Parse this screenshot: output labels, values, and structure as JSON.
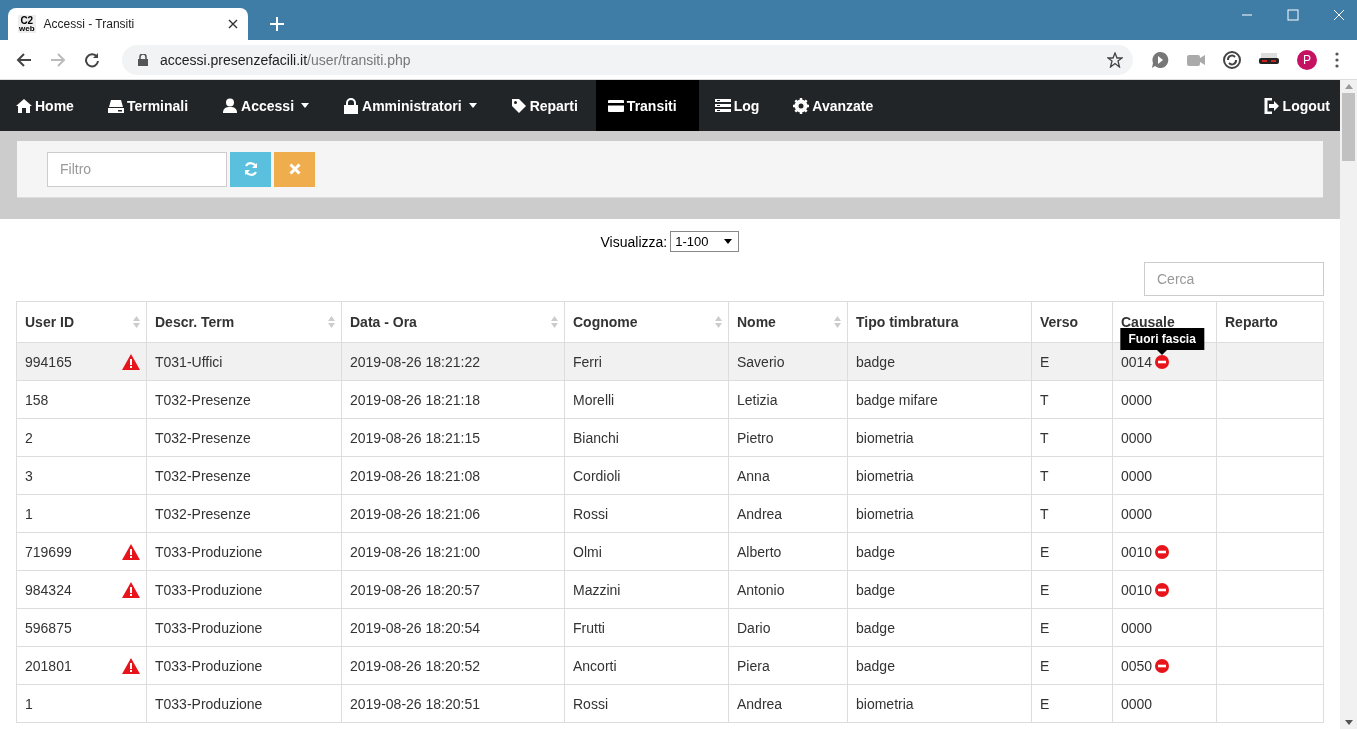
{
  "browser": {
    "favicon_text": [
      "C2",
      "web"
    ],
    "tab_title": "Accessi - Transiti",
    "url_host": "accessi.presenzefacili.it",
    "url_path": "/user/transiti.php",
    "profile_initial": "P"
  },
  "navbar": {
    "items": [
      {
        "label": "Home",
        "dropdown": false,
        "selected": false
      },
      {
        "label": "Terminali",
        "dropdown": false,
        "selected": false
      },
      {
        "label": "Accessi",
        "dropdown": true,
        "selected": false
      },
      {
        "label": "Amministratori",
        "dropdown": true,
        "selected": false
      },
      {
        "label": "Reparti",
        "dropdown": false,
        "selected": false
      },
      {
        "label": "Transiti",
        "dropdown": false,
        "selected": true
      },
      {
        "label": "Log",
        "dropdown": false,
        "selected": false
      },
      {
        "label": "Avanzate",
        "dropdown": false,
        "selected": false
      }
    ],
    "logout": "Logout"
  },
  "filter": {
    "placeholder": "Filtro"
  },
  "view": {
    "label": "Visualizza:",
    "value": "1-100"
  },
  "search": {
    "placeholder": "Cerca"
  },
  "table": {
    "columns": [
      {
        "label": "User ID",
        "sortable": true
      },
      {
        "label": "Descr. Term",
        "sortable": true
      },
      {
        "label": "Data - Ora",
        "sortable": true
      },
      {
        "label": "Cognome",
        "sortable": true
      },
      {
        "label": "Nome",
        "sortable": true
      },
      {
        "label": "Tipo timbratura",
        "sortable": false
      },
      {
        "label": "Verso",
        "sortable": false
      },
      {
        "label": "Causale",
        "sortable": false
      },
      {
        "label": "Reparto",
        "sortable": false
      }
    ],
    "rows": [
      {
        "cells": [
          "994165",
          "T031-Uffici",
          "2019-08-26 18:21:22",
          "Ferri",
          "Saverio",
          "badge",
          "E",
          "0014"
        ],
        "warning": true,
        "blocked": true,
        "hovered": true,
        "tooltip": "Fuori fascia"
      },
      {
        "cells": [
          "158",
          "T032-Presenze",
          "2019-08-26 18:21:18",
          "Morelli",
          "Letizia",
          "badge mifare",
          "T",
          "0000"
        ],
        "warning": false,
        "blocked": false,
        "hovered": false
      },
      {
        "cells": [
          "2",
          "T032-Presenze",
          "2019-08-26 18:21:15",
          "Bianchi",
          "Pietro",
          "biometria",
          "T",
          "0000"
        ],
        "warning": false,
        "blocked": false,
        "hovered": false
      },
      {
        "cells": [
          "3",
          "T032-Presenze",
          "2019-08-26 18:21:08",
          "Cordioli",
          "Anna",
          "biometria",
          "T",
          "0000"
        ],
        "warning": false,
        "blocked": false,
        "hovered": false
      },
      {
        "cells": [
          "1",
          "T032-Presenze",
          "2019-08-26 18:21:06",
          "Rossi",
          "Andrea",
          "biometria",
          "T",
          "0000"
        ],
        "warning": false,
        "blocked": false,
        "hovered": false
      },
      {
        "cells": [
          "719699",
          "T033-Produzione",
          "2019-08-26 18:21:00",
          "Olmi",
          "Alberto",
          "badge",
          "E",
          "0010"
        ],
        "warning": true,
        "blocked": true,
        "hovered": false
      },
      {
        "cells": [
          "984324",
          "T033-Produzione",
          "2019-08-26 18:20:57",
          "Mazzini",
          "Antonio",
          "badge",
          "E",
          "0010"
        ],
        "warning": true,
        "blocked": true,
        "hovered": false
      },
      {
        "cells": [
          "596875",
          "T033-Produzione",
          "2019-08-26 18:20:54",
          "Frutti",
          "Dario",
          "badge",
          "E",
          "0000"
        ],
        "warning": false,
        "blocked": false,
        "hovered": false
      },
      {
        "cells": [
          "201801",
          "T033-Produzione",
          "2019-08-26 18:20:52",
          "Ancorti",
          "Piera",
          "badge",
          "E",
          "0050"
        ],
        "warning": true,
        "blocked": true,
        "hovered": false
      },
      {
        "cells": [
          "1",
          "T033-Produzione",
          "2019-08-26 18:20:51",
          "Rossi",
          "Andrea",
          "biometria",
          "E",
          "0000"
        ],
        "warning": false,
        "blocked": false,
        "hovered": false
      }
    ]
  }
}
